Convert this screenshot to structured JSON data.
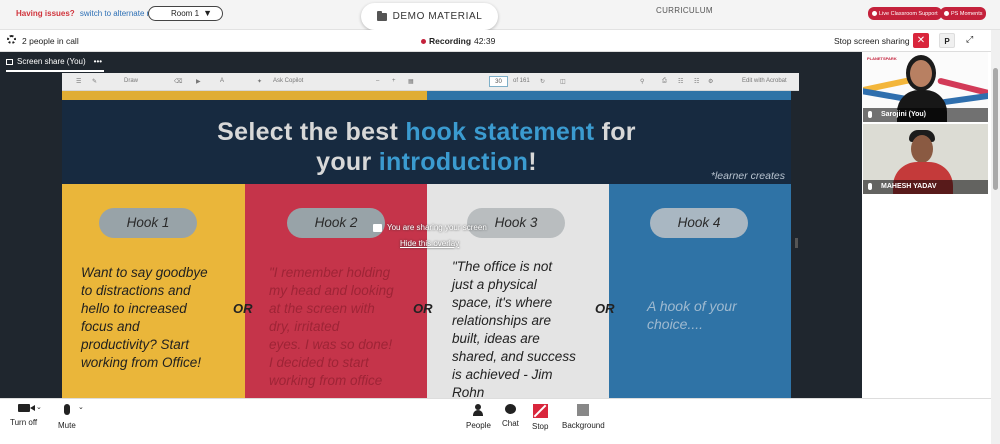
{
  "topbar": {
    "issues_label": "Having issues?",
    "alt_room_link": "switch to alternate room",
    "room_select": "Room 1",
    "demo_material": "DEMO MATERIAL",
    "curriculum": "CURRICULUM",
    "live_support": "Live Classroom Support",
    "ps_moments": "PS Moments"
  },
  "callbar": {
    "people_count": "2 people in call",
    "recording_label": "Recording",
    "recording_time": "42:39",
    "stop_sharing": "Stop screen sharing",
    "p_button": "P"
  },
  "share_tab": {
    "label": "Screen share (You)",
    "more": "•••"
  },
  "pdf_toolbar": {
    "draw": "Draw",
    "ask_copilot": "Ask Copilot",
    "page_num": "30",
    "page_total": "of 161",
    "edit_acrobat": "Edit with Acrobat"
  },
  "slide": {
    "title_part1": "Select the best ",
    "title_hl1": "hook statement",
    "title_part2": " for",
    "title_part3": "your ",
    "title_hl2": "introduction",
    "title_part4": "!",
    "learner_note": "*learner creates",
    "or_label": "OR",
    "hooks": [
      {
        "label": "Hook 1",
        "lines": [
          "Want to say goodbye",
          "to distractions and",
          "hello to increased",
          "focus and",
          "productivity? Start",
          "working from Office!"
        ]
      },
      {
        "label": "Hook 2",
        "lines": [
          "\"I remember holding",
          "my head and looking",
          "at the screen with",
          "dry, irritated",
          "eyes. I was so done!",
          "I decided to start",
          "working from office"
        ]
      },
      {
        "label": "Hook 3",
        "lines": [
          "\"The office is not",
          "just a physical",
          "space, it's where",
          "relationships are",
          "built, ideas are",
          "shared, and success",
          "is achieved - Jim",
          "Rohn"
        ]
      },
      {
        "label": "Hook 4",
        "lines": [
          "A hook of your",
          "choice...."
        ]
      }
    ]
  },
  "overlay": {
    "sharing_msg": "You are sharing your screen",
    "hide_link": "Hide this overlay"
  },
  "participants": [
    {
      "name": "Sarojini (You)"
    },
    {
      "name": "MAHESH YADAV"
    }
  ],
  "controls": {
    "turn_off": "Turn off",
    "mute": "Mute",
    "people": "People",
    "chat": "Chat",
    "stop": "Stop",
    "background": "Background"
  },
  "colors": {
    "accent_red": "#d9263c",
    "hook1": "#eab63a",
    "hook2": "#c5344a",
    "hook3": "#e4e4e4",
    "hook4": "#2f73a6",
    "slide_bg": "#172a40",
    "title_highlight": "#3b9bd0"
  }
}
